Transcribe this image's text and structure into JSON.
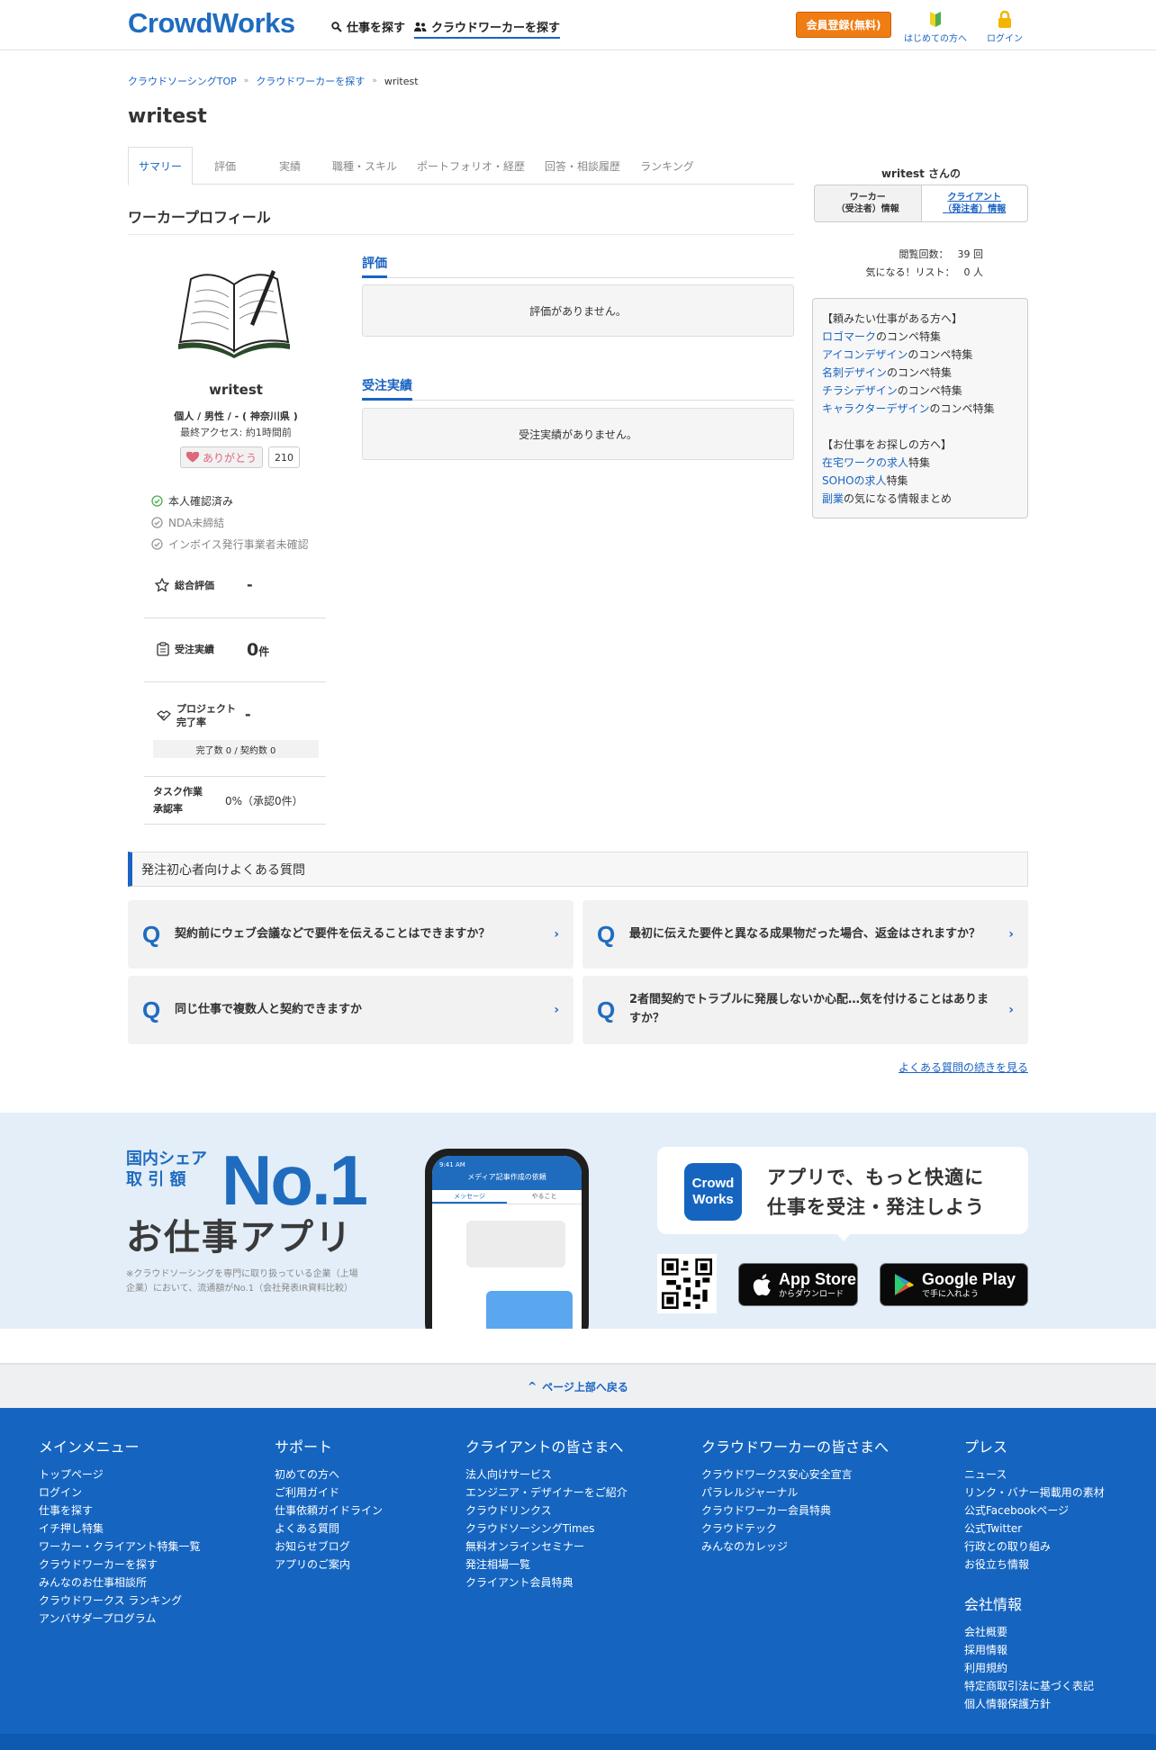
{
  "header": {
    "logo": "CrowdWorks",
    "nav_find_jobs": "仕事を探す",
    "nav_find_workers": "クラウドワーカーを探す",
    "register_button": "会員登録(無料)",
    "beginners": "はじめての方へ",
    "login": "ログイン"
  },
  "breadcrumb": {
    "items": [
      "クラウドソーシングTOP",
      "クラウドワーカーを探す",
      "writest"
    ]
  },
  "page_title": "writest",
  "tabs": [
    "サマリー",
    "評価",
    "実績",
    "職種・スキル",
    "ポートフォリオ・経歴",
    "回答・相談履歴",
    "ランキング"
  ],
  "section_title": "ワーカープロフィール",
  "profile": {
    "name": "writest",
    "meta": "個人 / 男性 / - ( 神奈川県 )",
    "last_access": "最終アクセス: 約1時間前",
    "thanks_label": "ありがとう",
    "thanks_count": "210",
    "checks": [
      "本人確認済み",
      "NDA未締結",
      "インボイス発行事業者未確認"
    ]
  },
  "stats": {
    "overall_label": "総合評価",
    "overall_value": "-",
    "orders_label": "受注実績",
    "orders_value": "0",
    "orders_unit": "件",
    "completion_label_1": "プロジェクト",
    "completion_label_2": "完了率",
    "completion_value": "-",
    "completion_sub": "完了数 0 / 契約数 0",
    "task_label_1": "タスク作業",
    "task_label_2": "承認率",
    "task_value": "0%（承認0件）"
  },
  "middle": {
    "eval_heading": "評価",
    "eval_empty": "評価がありません。",
    "orders_heading": "受注実績",
    "orders_empty": "受注実績がありません。"
  },
  "right": {
    "heading": "writest さんの",
    "tab_worker_1": "ワーカー",
    "tab_worker_2": "（受注者）情報",
    "tab_client_1": "クライアント",
    "tab_client_2": "（発注者）情報",
    "views_label": "閲覧回数：",
    "views_value": "39 回",
    "fav_label": "気になる！リスト：",
    "fav_value": "0 人",
    "panel_h1": "【頼みたい仕事がある方へ】",
    "l1a": "ロゴマーク",
    "l1b": "のコンペ特集",
    "l2a": "アイコンデザイン",
    "l2b": "のコンペ特集",
    "l3a": "名刺デザイン",
    "l3b": "のコンペ特集",
    "l4a": "チラシデザイン",
    "l4b": "のコンペ特集",
    "l5a": "キャラクターデザイン",
    "l5b": "のコンペ特集",
    "panel_h2": "【お仕事をお探しの方へ】",
    "m1a": "在宅ワークの求人",
    "m1b": "特集",
    "m2a": "SOHOの求人",
    "m2b": "特集",
    "m3a": "副業",
    "m3b": "の気になる情報まとめ"
  },
  "faq": {
    "heading": "発注初心者向けよくある質問",
    "q_mark": "Q",
    "items": [
      "契約前にウェブ会議などで要件を伝えることはできますか？",
      "最初に伝えた要件と異なる成果物だった場合、返金はされますか？",
      "同じ仕事で複数人と契約できますか",
      "2者間契約でトラブルに発展しないか心配…気を付けることはありますか？"
    ],
    "more": "よくある質問の続きを見る"
  },
  "app": {
    "share_1": "国内シェア",
    "share_2": "取 引 額",
    "no1": "No.1",
    "title": "お仕事アプリ",
    "note": "※クラウドソーシングを専門に取り扱っている企業（上場企業）において、流通額がNo.1（会社発表IR資料比較）",
    "icon_text_1": "Crowd",
    "icon_text_2": "Works",
    "bubble_1": "アプリで、もっと快適に",
    "bubble_2": "仕事を受注・発注しよう",
    "appstore_big": "App Store",
    "appstore_small": "からダウンロード",
    "gplay_big": "Google Play",
    "gplay_small": "で手に入れよう",
    "phone_header": "メディア記事作成の依頼",
    "phone_tab1": "メッセージ",
    "phone_tab2": "やること",
    "phone_time": "9:41 AM"
  },
  "back_to_top": "ページ上部へ戻る",
  "footer": {
    "main": {
      "title": "メインメニュー",
      "items": [
        "トップページ",
        "ログイン",
        "仕事を探す",
        "イチ押し特集",
        "ワーカー・クライアント特集一覧",
        "クラウドワーカーを探す",
        "みんなのお仕事相談所",
        "クラウドワークス ランキング",
        "アンバサダープログラム"
      ]
    },
    "support": {
      "title": "サポート",
      "items": [
        "初めての方へ",
        "ご利用ガイド",
        "仕事依頼ガイドライン",
        "よくある質問",
        "お知らせブログ",
        "アプリのご案内"
      ]
    },
    "client": {
      "title": "クライアントの皆さまへ",
      "items": [
        "法人向けサービス",
        "エンジニア・デザイナーをご紹介",
        "クラウドリンクス",
        "クラウドソーシングTimes",
        "無料オンラインセミナー",
        "発注相場一覧",
        "クライアント会員特典"
      ]
    },
    "worker": {
      "title": "クラウドワーカーの皆さまへ",
      "items": [
        "クラウドワークス安心安全宣言",
        "パラレルジャーナル",
        "クラウドワーカー会員特典",
        "クラウドテック",
        "みんなのカレッジ"
      ]
    },
    "press": {
      "title": "プレス",
      "items": [
        "ニュース",
        "リンク・バナー掲載用の素材",
        "公式Facebookページ",
        "公式Twitter",
        "行政との取り組み",
        "お役立ち情報"
      ]
    },
    "company": {
      "title": "会社情報",
      "items": [
        "会社概要",
        "採用情報",
        "利用規約",
        "特定商取引法に基づく表記",
        "個人情報保護方針"
      ]
    }
  },
  "colors": {
    "brand": "#1565c0",
    "accent": "#f07d14"
  }
}
